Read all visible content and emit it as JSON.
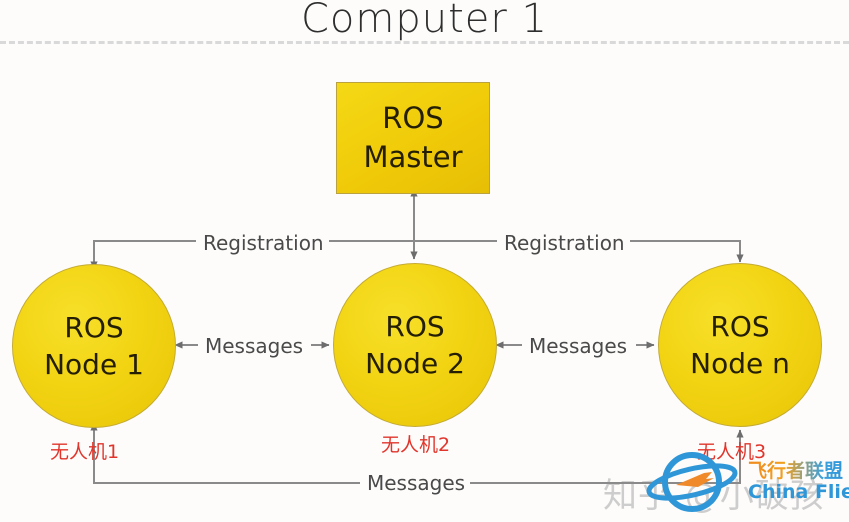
{
  "title": "Computer 1",
  "master": {
    "line1": "ROS",
    "line2": "Master"
  },
  "nodes": [
    {
      "line1": "ROS",
      "line2": "Node 1",
      "drone_label": "无人机1"
    },
    {
      "line1": "ROS",
      "line2": "Node 2",
      "drone_label": "无人机2"
    },
    {
      "line1": "ROS",
      "line2": "Node n",
      "drone_label": "无人机3"
    }
  ],
  "connections": {
    "registration_left": "Registration",
    "registration_right": "Registration",
    "messages_left": "Messages",
    "messages_right": "Messages",
    "messages_bottom": "Messages"
  },
  "watermarks": {
    "zhihu": "知乎 @小破孩",
    "flier_cn": "飞行者联盟",
    "flier_en": "China Flier"
  },
  "colors": {
    "node_fill": "#F2D413",
    "master_fill": "#EFC908",
    "drone_label": "#E1352B",
    "wire": "#8a8a8a",
    "divider": "#D9D9D9",
    "flier_blue": "#2F97D8",
    "flier_orange": "#F08A1E"
  }
}
